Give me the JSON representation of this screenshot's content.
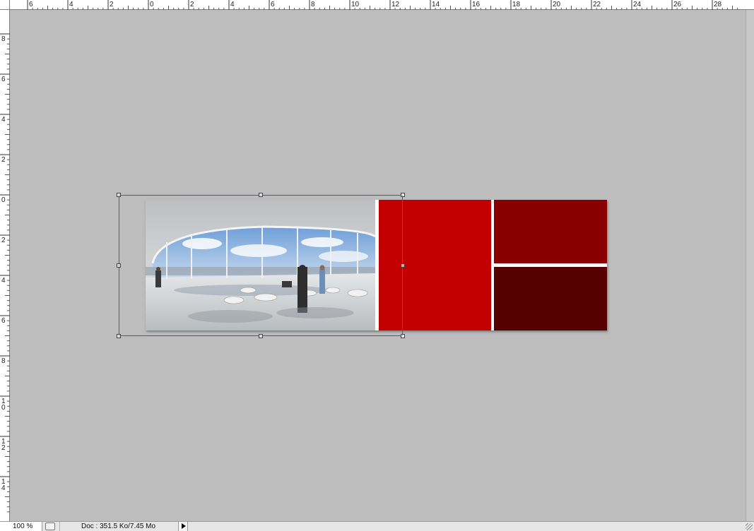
{
  "rulers": {
    "top_labels": [
      "6",
      "4",
      "2",
      "0",
      "2",
      "4",
      "6",
      "8",
      "10",
      "12",
      "14",
      "16",
      "18",
      "20",
      "22",
      "24",
      "26",
      "28"
    ],
    "left_labels": [
      "8",
      "6",
      "4",
      "2",
      "0",
      "2",
      "4",
      "6",
      "8",
      "10",
      "12",
      "14"
    ]
  },
  "status": {
    "zoom": "100 %",
    "doc_info": "Doc : 351.5 Ko/7.45 Mo"
  },
  "colors": {
    "canvas_bg": "#bdbdbd",
    "red": "#c20000",
    "dark_red_top": "#8a0000",
    "dark_red_bottom": "#560000"
  },
  "icons": {
    "status_icon": "document-status-icon",
    "menu_arrow": "triangle-right-icon",
    "grip": "resize-grip-icon"
  }
}
